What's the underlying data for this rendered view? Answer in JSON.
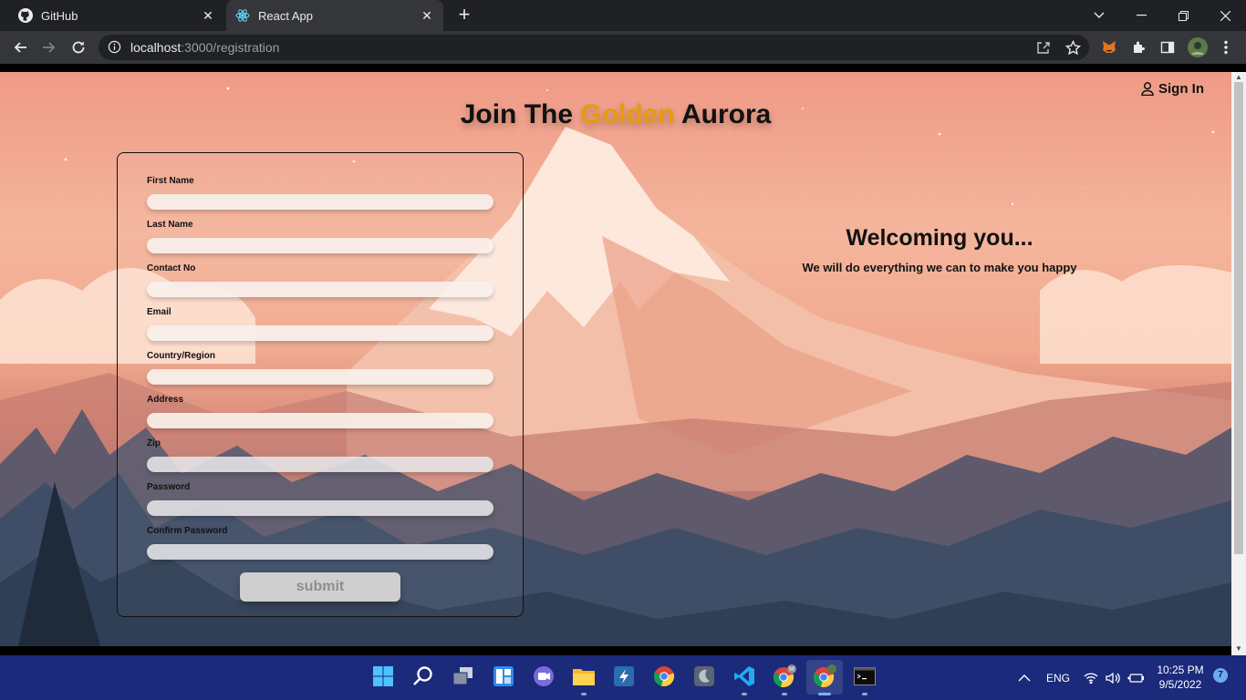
{
  "browser": {
    "tabs": [
      {
        "title": "GitHub",
        "icon": "github-icon"
      },
      {
        "title": "React App",
        "icon": "react-icon",
        "active": true
      }
    ],
    "url": {
      "host": "localhost",
      "path": ":3000/registration"
    }
  },
  "header": {
    "title_before": "Join The",
    "title_accent": "Golden",
    "title_after": "Aurora",
    "accent_color": "#e69a12",
    "signin_label": "Sign In"
  },
  "form": {
    "fields": [
      {
        "label": "First Name",
        "value": ""
      },
      {
        "label": "Last Name",
        "value": ""
      },
      {
        "label": "Contact No",
        "value": ""
      },
      {
        "label": "Email",
        "value": ""
      },
      {
        "label": "Country/Region",
        "value": ""
      },
      {
        "label": "Address",
        "value": ""
      },
      {
        "label": "Zip",
        "value": ""
      },
      {
        "label": "Password",
        "value": ""
      },
      {
        "label": "Confirm Password",
        "value": ""
      }
    ],
    "submit_label": "submit"
  },
  "welcome": {
    "title": "Welcoming you...",
    "subtitle": "We will do everything we can to make you happy"
  },
  "taskbar": {
    "language": "ENG",
    "time": "10:25 PM",
    "date": "9/5/2022",
    "notifications": "7",
    "apps": [
      "windows-start-icon",
      "search-icon",
      "task-view-icon",
      "widgets-icon",
      "chat-icon",
      "file-explorer-icon",
      "app-icon",
      "chrome-icon",
      "app-icon",
      "vscode-icon",
      "chrome-profile-icon",
      "chrome-active-icon",
      "terminal-icon"
    ]
  }
}
